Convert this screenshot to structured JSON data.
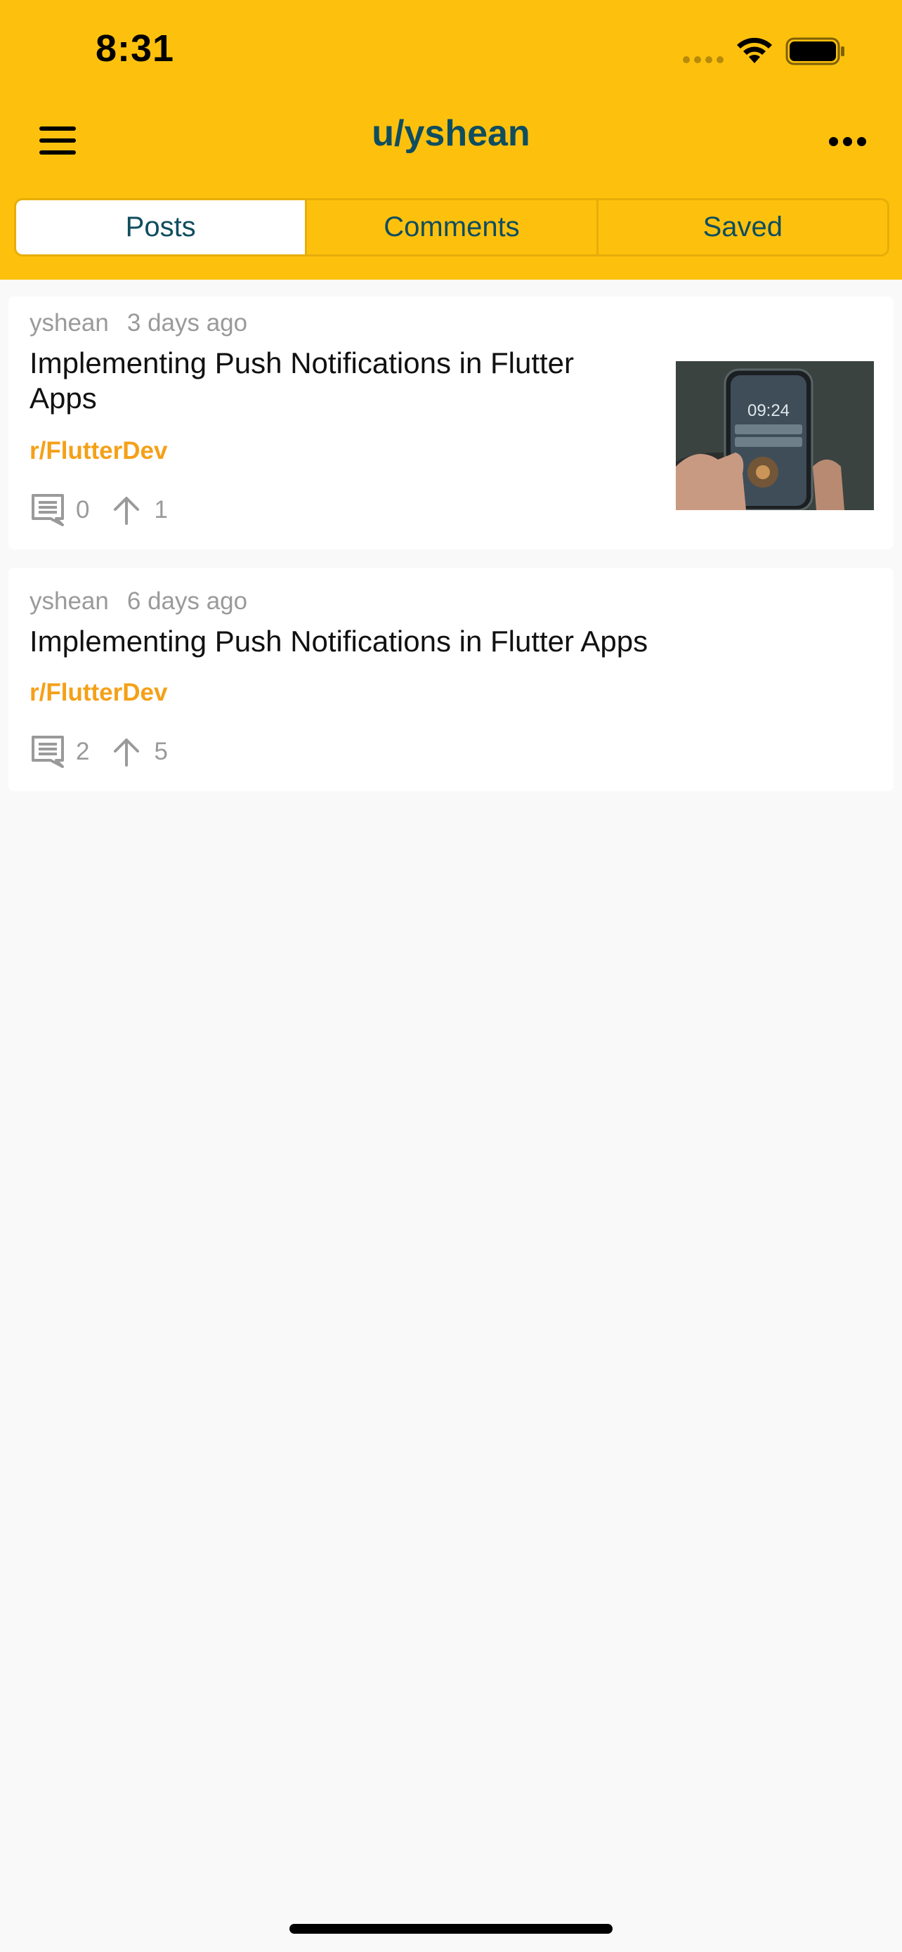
{
  "status_bar": {
    "time": "8:31"
  },
  "header": {
    "title": "u/yshean"
  },
  "tabs": [
    {
      "label": "Posts",
      "active": true
    },
    {
      "label": "Comments",
      "active": false
    },
    {
      "label": "Saved",
      "active": false
    }
  ],
  "posts": [
    {
      "author": "yshean",
      "time": "3 days ago",
      "title_line1": "Implementing Push Notifications in Flutter",
      "title_line2": "Apps",
      "subreddit": "r/FlutterDev",
      "comments": "0",
      "upvotes": "1",
      "thumbnail_time": "09:24"
    },
    {
      "author": "yshean",
      "time": "6 days ago",
      "title_line1": "Implementing Push Notifications in Flutter Apps",
      "subreddit": "r/FlutterDev",
      "comments": "2",
      "upvotes": "5"
    }
  ],
  "colors": {
    "header_bg": "#fdc10d",
    "title": "#0f4d5f",
    "subreddit": "#f5a018",
    "meta": "#9a9a9a"
  }
}
